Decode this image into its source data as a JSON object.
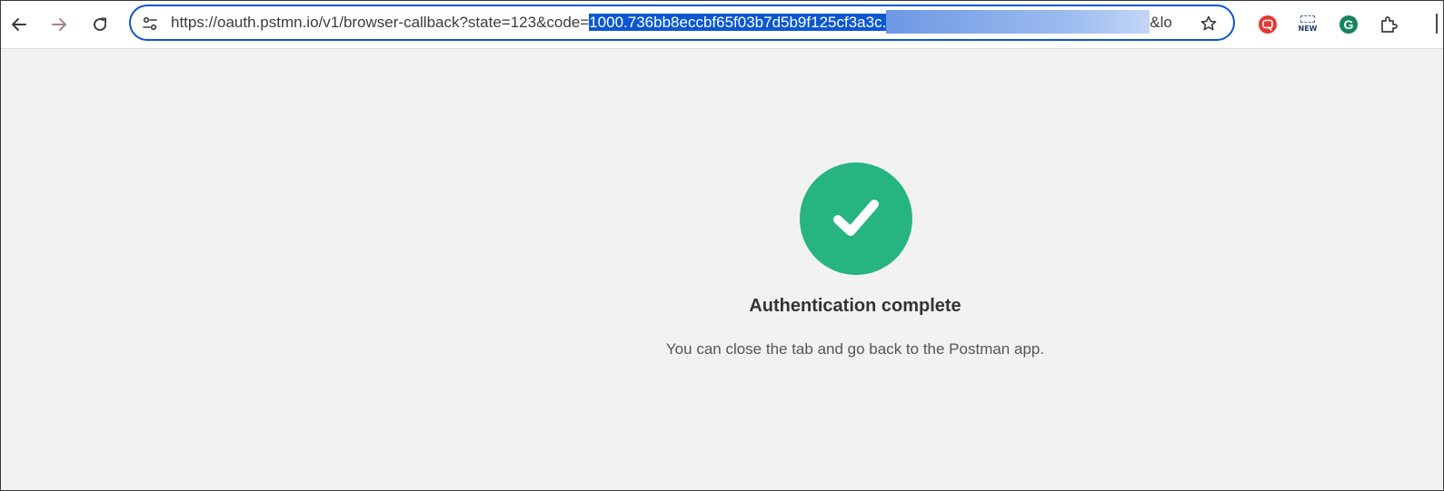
{
  "browser": {
    "url_prefix": "https://oauth.pstmn.io/v1/browser-callback?state=123&code=",
    "url_selected": "1000.736bb8eccbf65f03b7d5b9f125cf3a3c.",
    "url_suffix": "&lo",
    "accent_color": "#0b57d0",
    "icons": {
      "back": "arrow-left-icon",
      "forward": "arrow-right-icon",
      "reload": "reload-icon",
      "site_info": "tune-icon",
      "bookmark": "star-icon",
      "extensions": [
        "red-chat-extension-icon",
        "new-badge-extension-icon",
        "grammarly-extension-icon",
        "puzzle-icon"
      ]
    },
    "ext_new_label": "NEW",
    "ext_grammarly_label": "G"
  },
  "page": {
    "title": "Authentication complete",
    "message": "You can close the tab and go back to the Postman app.",
    "success_color": "#26b581",
    "background_color": "#f2f2f2"
  }
}
